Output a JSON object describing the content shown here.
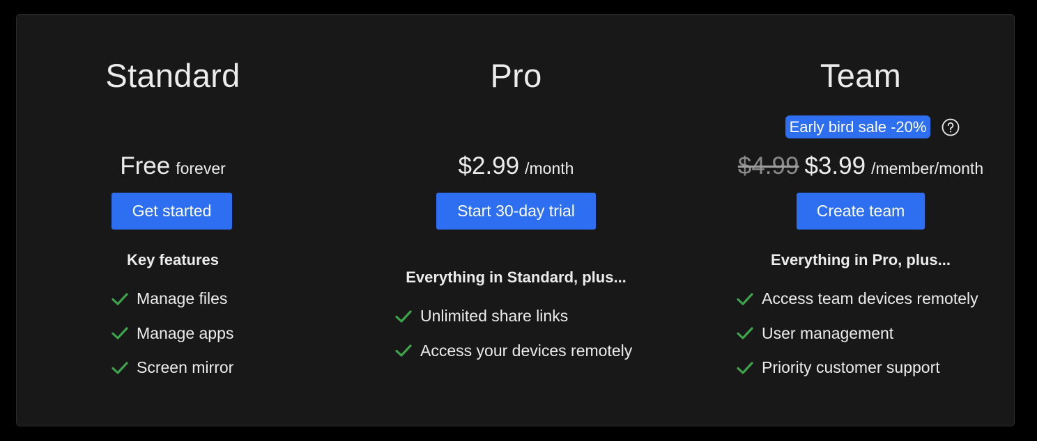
{
  "plans": {
    "standard": {
      "title": "Standard",
      "price": "Free",
      "unit": "forever",
      "button": "Get started",
      "heading": "Key features",
      "features": [
        "Manage files",
        "Manage apps",
        "Screen mirror"
      ]
    },
    "pro": {
      "title": "Pro",
      "price": "$2.99",
      "unit": "/month",
      "button": "Start 30-day trial",
      "heading": "Everything in Standard, plus...",
      "features": [
        "Unlimited share links",
        "Access your devices remotely"
      ]
    },
    "team": {
      "title": "Team",
      "badge": "Early bird sale -20%",
      "old_price": "$4.99",
      "price": "$3.99",
      "unit": "/member/month",
      "button": "Create team",
      "heading": "Everything in Pro, plus...",
      "features": [
        "Access team devices remotely",
        "User management",
        "Priority customer support"
      ]
    }
  },
  "icons": {
    "check": "check-icon",
    "help": "help-circle-icon"
  },
  "colors": {
    "background": "#000000",
    "panel": "#181818",
    "accent": "#2e6ff1",
    "check": "#3fa34d",
    "text": "#ececec",
    "muted": "#8a8a8a"
  }
}
